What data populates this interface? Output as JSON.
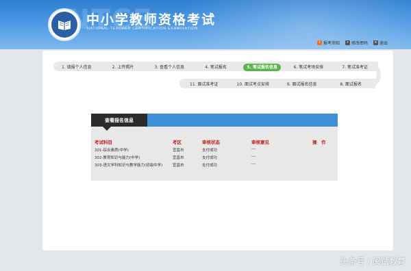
{
  "header": {
    "title_cn": "中小学教师资格考试",
    "title_en": "NATIONAL TEACHER CERTIFICATION EXAMINATION",
    "watermark": "NTCE"
  },
  "toplinks": [
    {
      "label": "报考须知",
      "icon": "notice-icon",
      "color": "#e8742a"
    },
    {
      "label": "修改密码",
      "icon": "key-icon",
      "color": "#555555"
    },
    {
      "label": "退出",
      "icon": "logout-icon",
      "color": "#555555"
    }
  ],
  "steps_row1": [
    {
      "label": "1. 填报个人信息",
      "active": false
    },
    {
      "label": "2. 上传照片",
      "active": false
    },
    {
      "label": "3. 查看个人信息",
      "active": false
    },
    {
      "label": "4. 笔试报名",
      "active": false
    },
    {
      "label": "5. 笔试报名信息",
      "active": true
    },
    {
      "label": "6. 笔试考场安排",
      "active": false
    },
    {
      "label": "7. 笔试准考证",
      "active": false
    }
  ],
  "steps_row2": [
    {
      "label": "11. 面试准考证"
    },
    {
      "label": "10. 面试考点安排"
    },
    {
      "label": "9. 面试报名信息"
    },
    {
      "label": "8. 面试报名"
    }
  ],
  "panel": {
    "tab_label": "查看报名信息",
    "headers": [
      "考试科目",
      "考区",
      "审核状态",
      "审核意见",
      "操　作"
    ],
    "rows": [
      [
        "301-综合素质(中学)",
        "宜昌市",
        "支付成功",
        "---",
        ""
      ],
      [
        "302-教育知识与能力(中学)",
        "宜昌市",
        "支付成功",
        "---",
        ""
      ],
      [
        "303-语文学科知识与教学能力(初级中学)",
        "宜昌市",
        "支付成功",
        "---",
        ""
      ]
    ]
  },
  "footer_watermark": "头条号 / 闽试教育",
  "colors": {
    "accent_green": "#58b648",
    "header_blue": "#3f8fd6",
    "table_header_red": "#c0201a"
  }
}
